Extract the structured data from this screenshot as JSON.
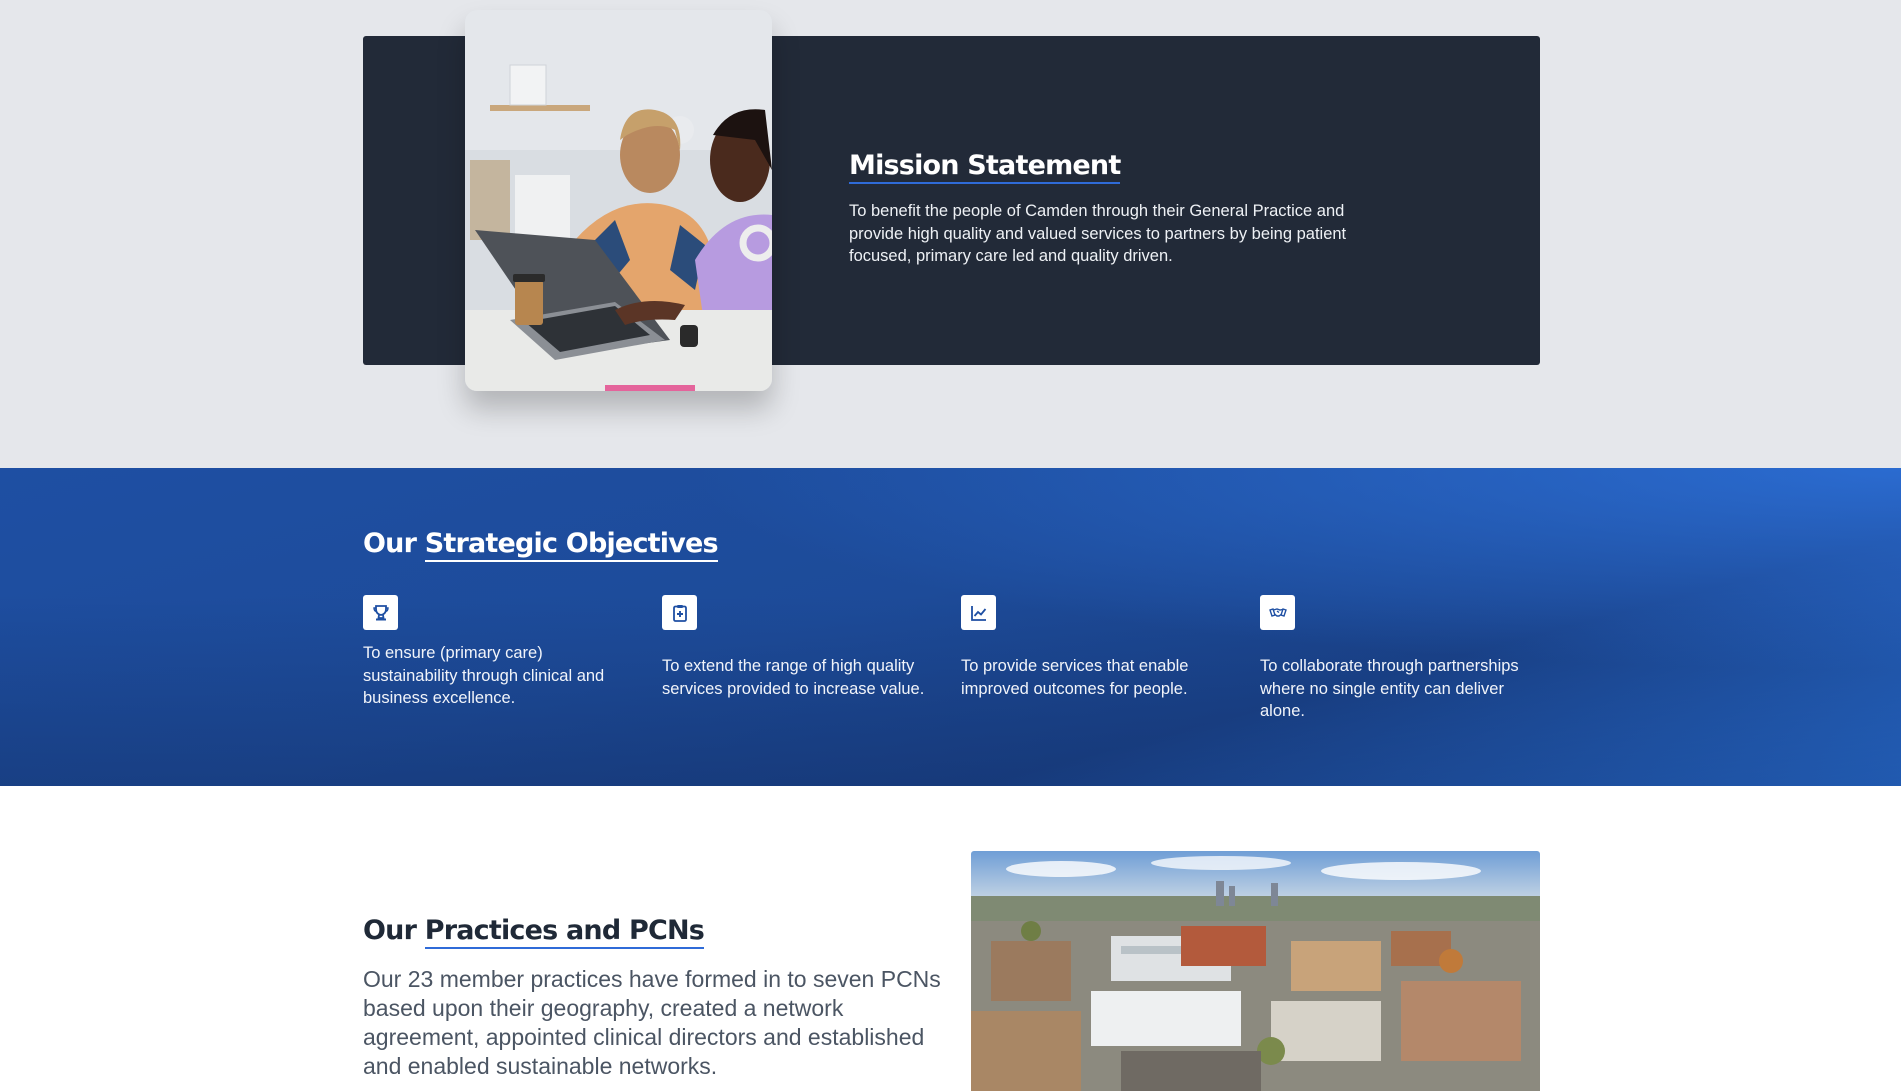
{
  "mission": {
    "title": "Mission Statement",
    "body": "To benefit the people of Camden through their General Practice and provide high quality and valued services to partners by being patient focused, primary care led and quality driven.",
    "photo_icon": "people-at-laptop-photo"
  },
  "objectives": {
    "heading_prefix": "Our",
    "heading_accent": "Strategic Objectives",
    "items": [
      {
        "icon": "trophy-icon",
        "text": "To ensure (primary care) sustainability through clinical and business excellence."
      },
      {
        "icon": "clipboard-medical-icon",
        "text": "To extend the range of high quality services provided to increase value."
      },
      {
        "icon": "chart-line-icon",
        "text": "To provide services that enable improved outcomes for people."
      },
      {
        "icon": "handshake-icon",
        "text": "To collaborate through partnerships where no single entity can deliver alone."
      }
    ]
  },
  "practices": {
    "heading_prefix": "Our",
    "heading_accent": "Practices and PCNs",
    "body": "Our 23 member practices have formed in to seven PCNs based upon their geography, created a network agreement, appointed clinical directors and established and enabled sustainable networks.",
    "photo_icon": "aerial-city-photo"
  },
  "colors": {
    "mission_card_bg": "#222a38",
    "objectives_bg": "#1e4fa3",
    "accent_underline": "#2f6bd8",
    "page_bg": "#e5e7eb"
  }
}
